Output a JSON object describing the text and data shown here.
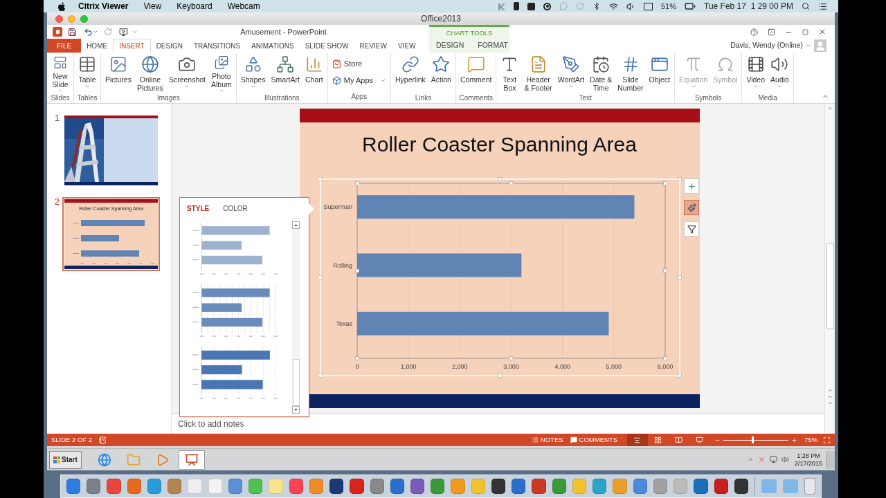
{
  "menu_bar": {
    "app": "Citrix Viewer",
    "items": [
      "View",
      "Keyboard",
      "Webcam"
    ],
    "battery": "51%",
    "clock": "Tue Feb 17  1 29 00 PM"
  },
  "window": {
    "title": "Office2013"
  },
  "document_title": "Amusement - PowerPoint",
  "tabs": [
    {
      "label": "FILE",
      "kind": "file",
      "selected": false
    },
    {
      "label": "HOME",
      "kind": "tab",
      "selected": false
    },
    {
      "label": "INSERT",
      "kind": "tab",
      "selected": true
    },
    {
      "label": "DESIGN",
      "kind": "tab",
      "selected": false
    },
    {
      "label": "TRANSITIONS",
      "kind": "tab",
      "selected": false
    },
    {
      "label": "ANIMATIONS",
      "kind": "tab",
      "selected": false
    },
    {
      "label": "SLIDE SHOW",
      "kind": "tab",
      "selected": false
    },
    {
      "label": "REVIEW",
      "kind": "tab",
      "selected": false
    },
    {
      "label": "VIEW",
      "kind": "tab",
      "selected": false
    }
  ],
  "chart_tools": {
    "label": "CHART TOOLS",
    "tabs": [
      {
        "label": "DESIGN",
        "selected": false
      },
      {
        "label": "FORMAT",
        "selected": false
      }
    ]
  },
  "user": "Davis, Wendy (Online)",
  "ribbon": [
    {
      "label": "Slides",
      "buttons": [
        {
          "label": "New\nSlide",
          "kind": "large",
          "dropdown": true,
          "disabled": false
        }
      ]
    },
    {
      "label": "Tables",
      "buttons": [
        {
          "label": "Table",
          "kind": "large",
          "dropdown": true,
          "disabled": false
        }
      ]
    },
    {
      "label": "Images",
      "buttons": [
        {
          "label": "Pictures",
          "kind": "large",
          "dropdown": false,
          "disabled": false
        },
        {
          "label": "Online\nPictures",
          "kind": "large",
          "dropdown": false,
          "disabled": false
        },
        {
          "label": "Screenshot",
          "kind": "large",
          "dropdown": true,
          "disabled": false
        },
        {
          "label": "Photo\nAlbum",
          "kind": "large",
          "dropdown": true,
          "disabled": false
        }
      ]
    },
    {
      "label": "Illustrations",
      "buttons": [
        {
          "label": "Shapes",
          "kind": "large",
          "dropdown": true,
          "disabled": false
        },
        {
          "label": "SmartArt",
          "kind": "large",
          "dropdown": false,
          "disabled": false
        },
        {
          "label": "Chart",
          "kind": "large",
          "dropdown": false,
          "disabled": false
        }
      ]
    },
    {
      "label": "Apps",
      "buttons": [
        {
          "label": "Store",
          "kind": "small",
          "dropdown": false,
          "disabled": false
        },
        {
          "label": "My Apps",
          "kind": "small",
          "dropdown": true,
          "disabled": false
        }
      ]
    },
    {
      "label": "Links",
      "buttons": [
        {
          "label": "Hyperlink",
          "kind": "large",
          "dropdown": false,
          "disabled": false
        },
        {
          "label": "Action",
          "kind": "large",
          "dropdown": false,
          "disabled": false
        }
      ]
    },
    {
      "label": "Comments",
      "buttons": [
        {
          "label": "Comment",
          "kind": "large",
          "dropdown": false,
          "disabled": false
        }
      ]
    },
    {
      "label": "Text",
      "buttons": [
        {
          "label": "Text\nBox",
          "kind": "large",
          "dropdown": false,
          "disabled": false
        },
        {
          "label": "Header\n& Footer",
          "kind": "large",
          "dropdown": false,
          "disabled": false
        },
        {
          "label": "WordArt",
          "kind": "large",
          "dropdown": true,
          "disabled": false
        },
        {
          "label": "Date &\nTime",
          "kind": "large",
          "dropdown": false,
          "disabled": false
        },
        {
          "label": "Slide\nNumber",
          "kind": "large",
          "dropdown": false,
          "disabled": false
        },
        {
          "label": "Object",
          "kind": "large",
          "dropdown": false,
          "disabled": false
        }
      ]
    },
    {
      "label": "Symbols",
      "buttons": [
        {
          "label": "Equation",
          "kind": "large",
          "dropdown": true,
          "disabled": true
        },
        {
          "label": "Symbol",
          "kind": "large",
          "dropdown": false,
          "disabled": true
        }
      ]
    },
    {
      "label": "Media",
      "buttons": [
        {
          "label": "Video",
          "kind": "large",
          "dropdown": true,
          "disabled": false
        },
        {
          "label": "Audio",
          "kind": "large",
          "dropdown": true,
          "disabled": false
        }
      ]
    }
  ],
  "slides": [
    {
      "number": "1",
      "selected": false
    },
    {
      "number": "2",
      "kind": "chart",
      "selected": true,
      "title": "Roller Coaster Spanning Area"
    }
  ],
  "chart_style_panel": {
    "tabs": [
      {
        "label": "STYLE",
        "selected": true
      },
      {
        "label": "COLOR",
        "selected": false
      }
    ],
    "styles": [
      {
        "kind": "light"
      },
      {
        "kind": "gridlines"
      },
      {
        "kind": "shaded"
      }
    ]
  },
  "slide": {
    "title": "Roller Coaster Spanning Area",
    "chart_data": {
      "type": "bar",
      "orientation": "horizontal",
      "categories": [
        "Superman",
        "Rolling",
        "Texas"
      ],
      "series": [
        {
          "color": "#6084b3",
          "values": [
            5400,
            3200,
            4900
          ]
        }
      ],
      "xlim": [
        0,
        6000
      ],
      "grid": true,
      "xticks": [
        {
          "value": 0,
          "label": "0"
        },
        {
          "value": 1000,
          "label": "1,000"
        },
        {
          "value": 2000,
          "label": "2,000"
        },
        {
          "value": 3000,
          "label": "3,000"
        },
        {
          "value": 4000,
          "label": "4,000"
        },
        {
          "value": 5000,
          "label": "5,000"
        },
        {
          "value": 6000,
          "label": "6,000"
        }
      ]
    }
  },
  "chart_buttons": [
    {
      "kind": "add",
      "selected": false
    },
    {
      "kind": "style",
      "selected": true
    },
    {
      "kind": "filter",
      "selected": false
    }
  ],
  "notes_placeholder": "Click to add notes",
  "status_bar": {
    "slide_indicator": "SLIDE 2 OF 2",
    "notes": "NOTES",
    "comments": "COMMENTS",
    "views": [
      {
        "selected": true
      },
      {
        "selected": false
      },
      {
        "selected": false
      },
      {
        "selected": false
      }
    ],
    "zoom": {
      "level": 0.45,
      "reading": "75%"
    }
  },
  "taskbar": {
    "start": "Start",
    "apps": [
      {
        "selected": false
      },
      {
        "selected": false
      },
      {
        "selected": false
      },
      {
        "selected": true
      }
    ],
    "time": "1:28 PM",
    "date": "2/17/2015"
  }
}
